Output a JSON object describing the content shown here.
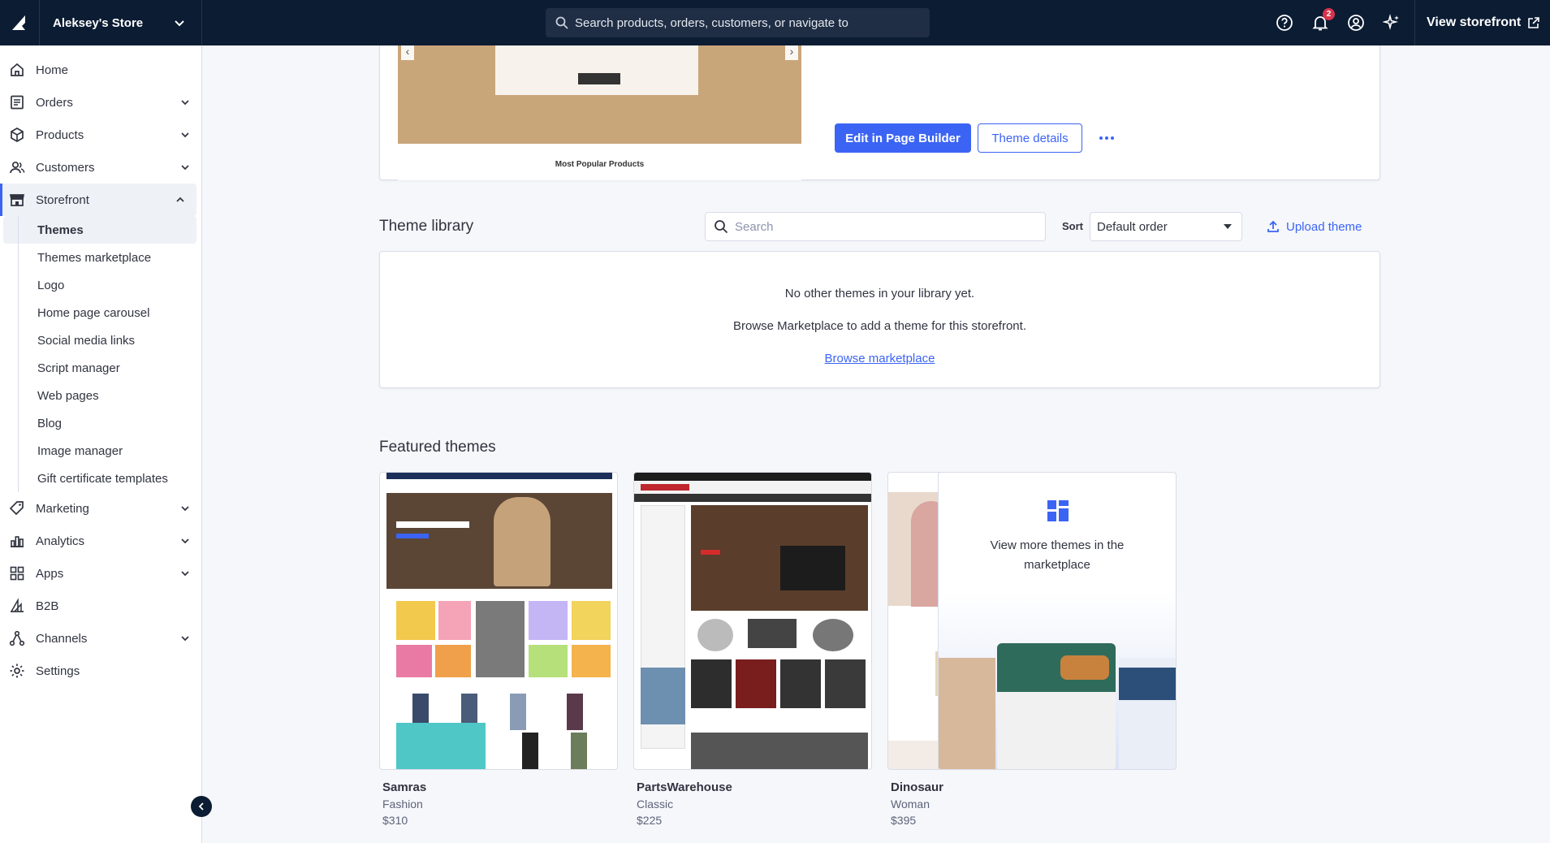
{
  "topbar": {
    "store_name": "Aleksey's Store",
    "search_placeholder": "Search products, orders, customers, or navigate to",
    "notifications_count": "2",
    "view_storefront": "View storefront"
  },
  "sidebar": {
    "items": [
      {
        "label": "Home"
      },
      {
        "label": "Orders"
      },
      {
        "label": "Products"
      },
      {
        "label": "Customers"
      },
      {
        "label": "Storefront"
      },
      {
        "label": "Marketing"
      },
      {
        "label": "Analytics"
      },
      {
        "label": "Apps"
      },
      {
        "label": "B2B"
      },
      {
        "label": "Channels"
      },
      {
        "label": "Settings"
      }
    ],
    "storefront_sub": [
      "Themes",
      "Themes marketplace",
      "Logo",
      "Home page carousel",
      "Social media links",
      "Script manager",
      "Web pages",
      "Blog",
      "Image manager",
      "Gift certificate templates"
    ]
  },
  "current_theme": {
    "preview_caption": "Most Popular Products",
    "edit_button": "Edit in Page Builder",
    "details_button": "Theme details"
  },
  "library": {
    "title": "Theme library",
    "search_placeholder": "Search",
    "sort_label": "Sort",
    "sort_value": "Default order",
    "upload_label": "Upload theme",
    "empty_line1": "No other themes in your library yet.",
    "empty_line2": "Browse Marketplace to add a theme for this storefront.",
    "browse_link": "Browse marketplace"
  },
  "featured": {
    "title": "Featured themes",
    "themes": [
      {
        "name": "Samras",
        "category": "Fashion",
        "price": "$310"
      },
      {
        "name": "PartsWarehouse",
        "category": "Classic",
        "price": "$225"
      },
      {
        "name": "Dinosaur",
        "category": "Woman",
        "price": "$395"
      }
    ],
    "promo_text": "View more themes in the marketplace"
  },
  "colors": {
    "topbar_bg": "#0b1c33",
    "accent": "#3c64f4",
    "badge": "#d9334b"
  }
}
